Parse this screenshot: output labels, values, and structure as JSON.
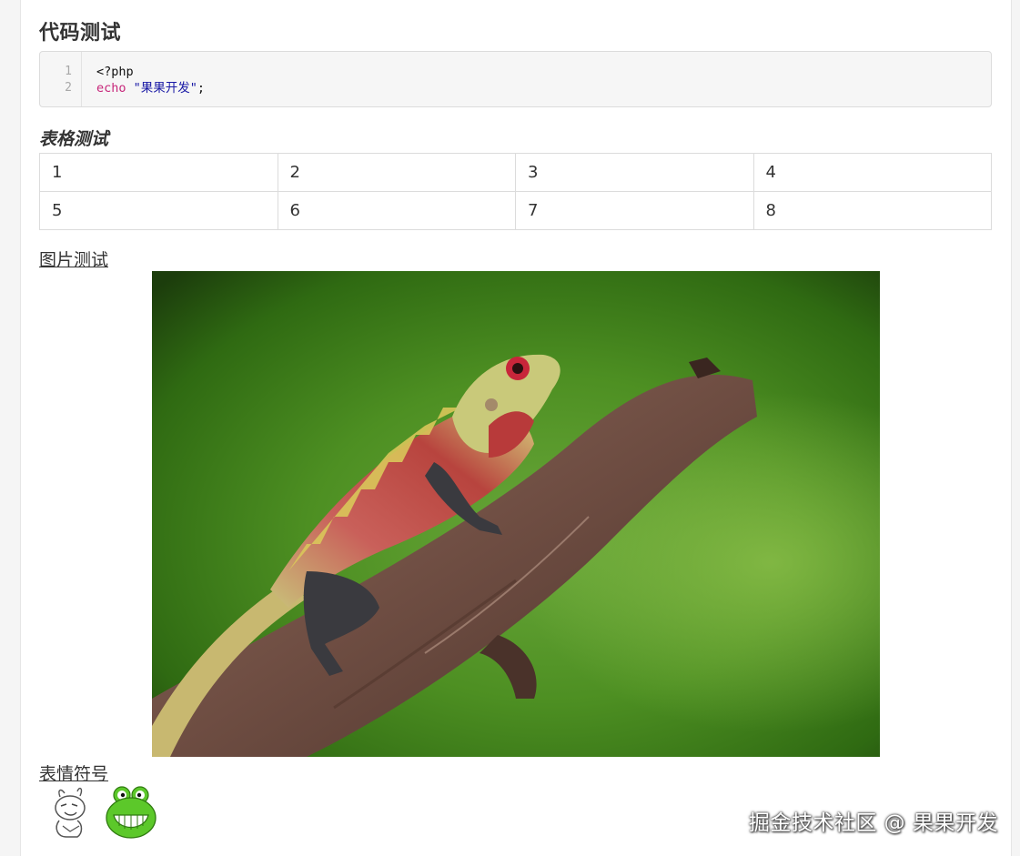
{
  "sections": {
    "code_title": "代码测试",
    "table_title": "表格测试",
    "image_title": "图片测试",
    "emoji_title": "表情符号"
  },
  "code_block": {
    "line_numbers": [
      "1",
      "2"
    ],
    "line1": "<?php",
    "line2_keyword": "echo",
    "line2_string": "\"果果开发\"",
    "line2_end": ";"
  },
  "table": {
    "rows": [
      [
        "1",
        "2",
        "3",
        "4"
      ],
      [
        "5",
        "6",
        "7",
        "8"
      ]
    ]
  },
  "image": {
    "icon": "lizard-photo"
  },
  "emojis": [
    {
      "icon": "rabbit-sketch-emoji"
    },
    {
      "icon": "green-frog-grin-emoji"
    }
  ],
  "watermark": "掘金技术社区 @ 果果开发",
  "colors": {
    "code_keyword": "#c7267a",
    "code_string": "#1a1aa6",
    "code_background": "#f6f6f6"
  }
}
